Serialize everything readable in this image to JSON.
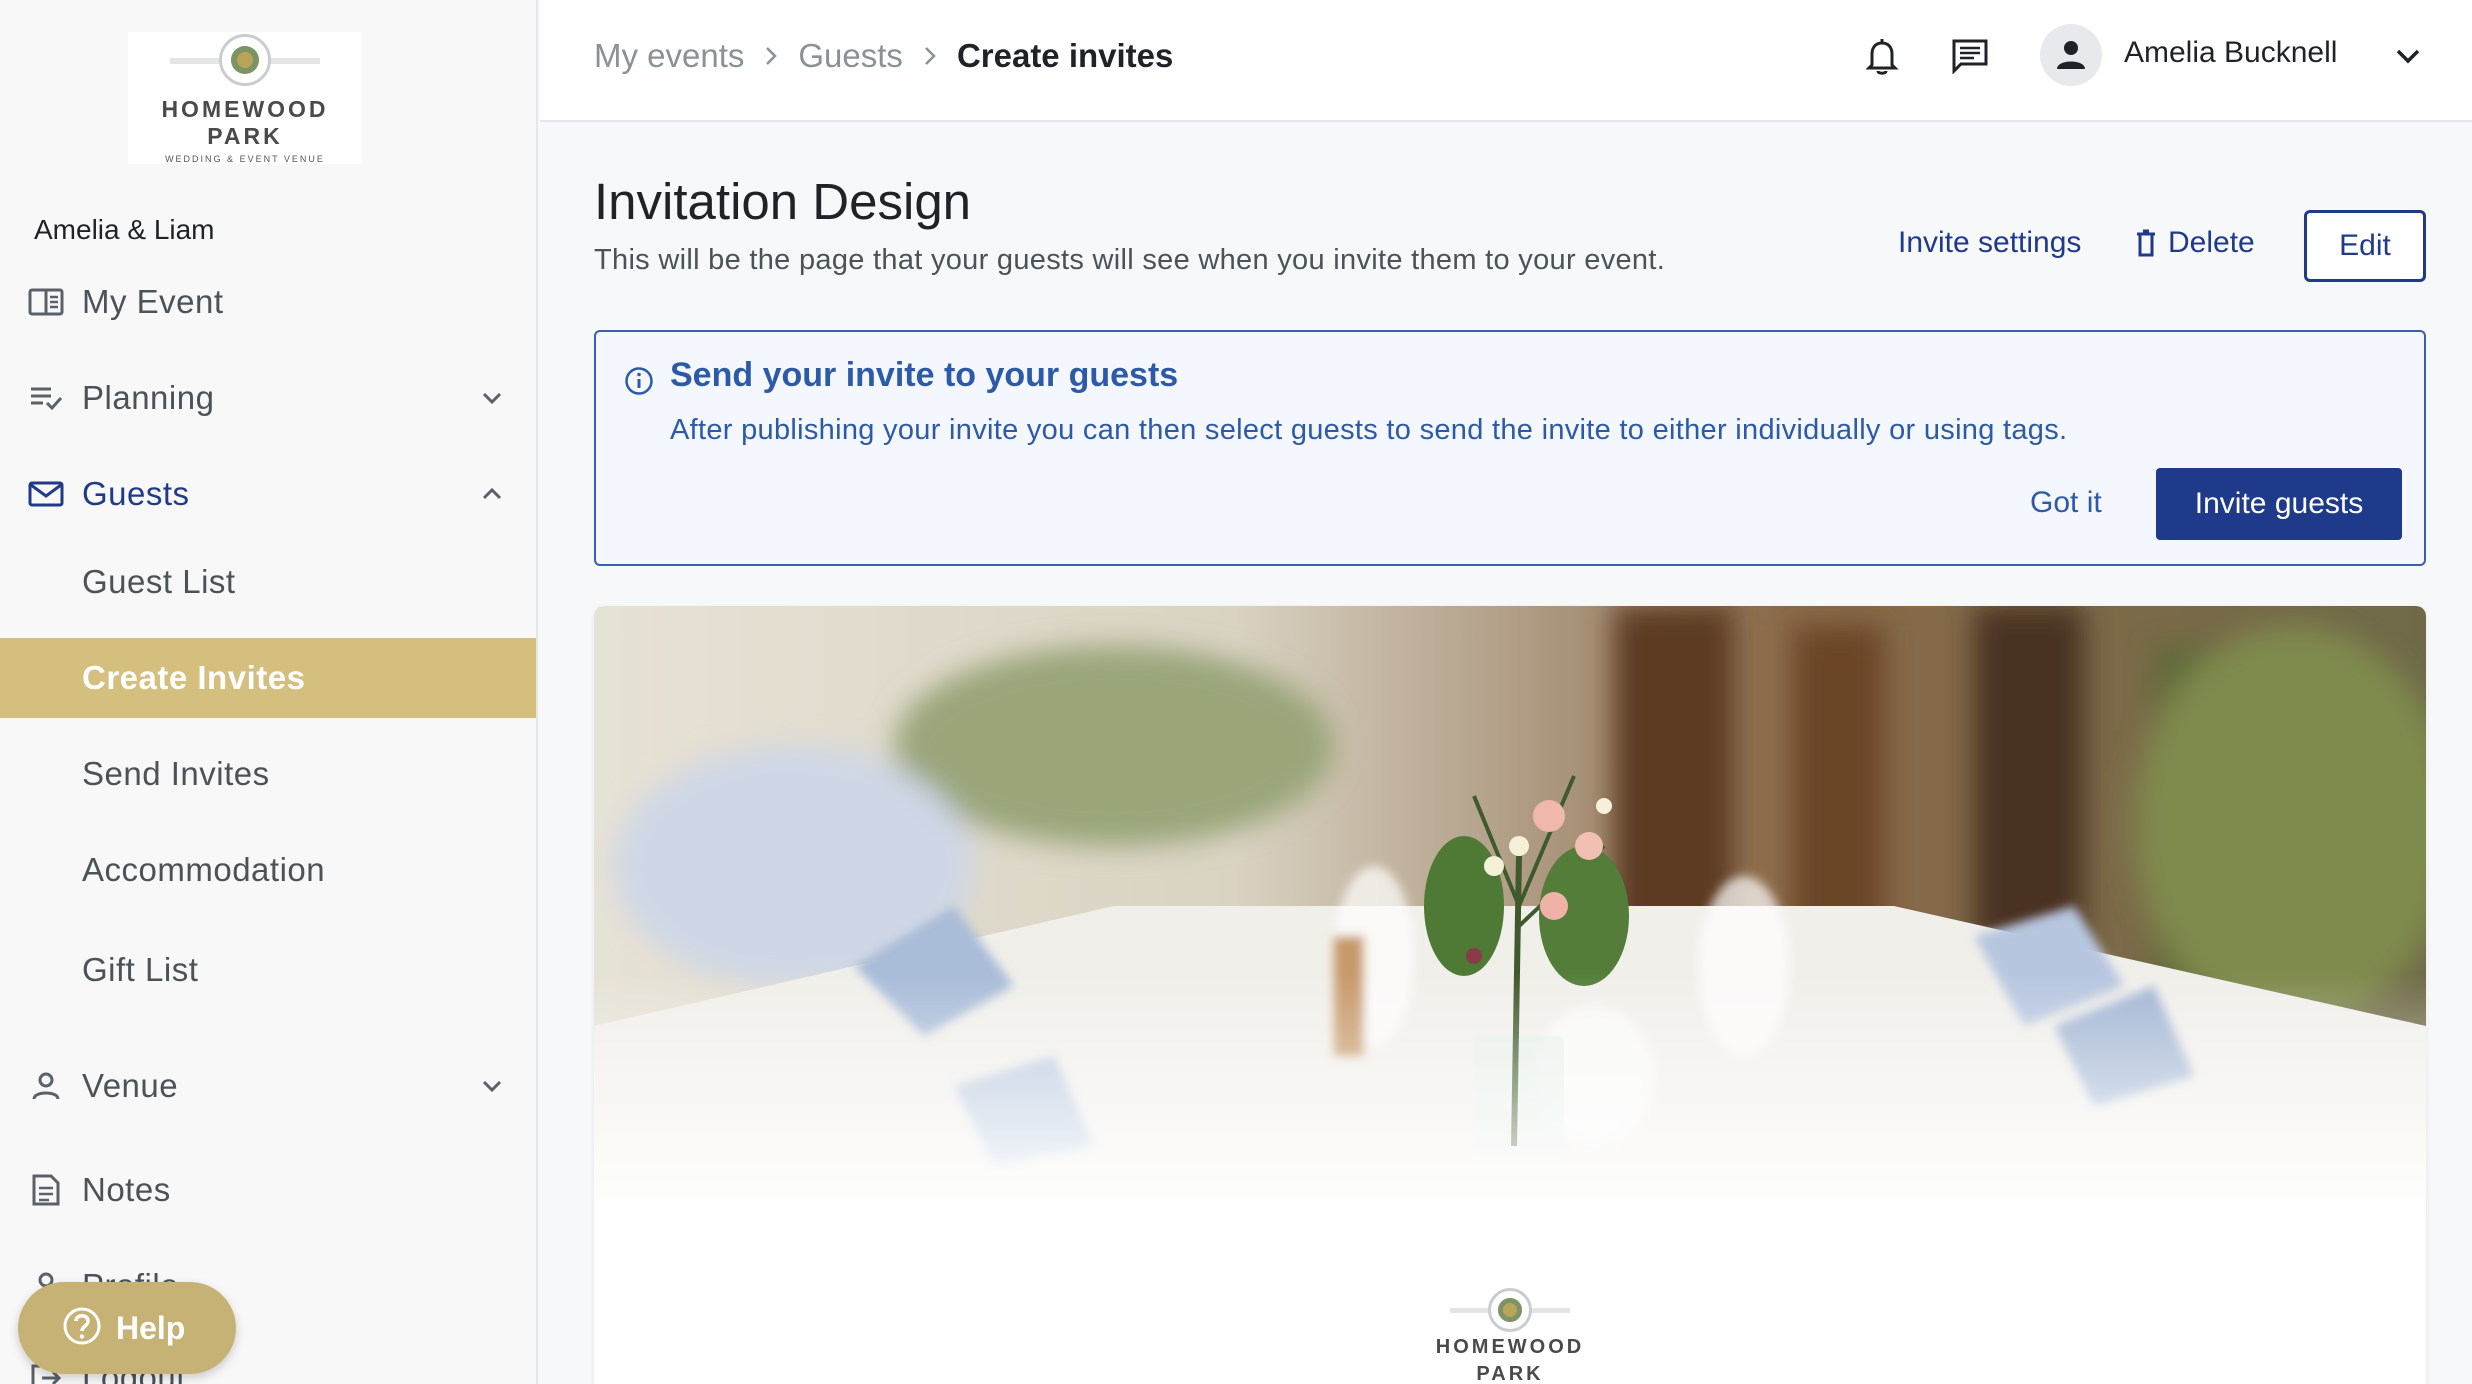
{
  "brand": {
    "logo_line1": "HOMEWOOD",
    "logo_line2": "PARK",
    "logo_tagline": "WEDDING & EVENT VENUE",
    "accent_color": "#d4bf7f",
    "primary_color": "#1f3a8a"
  },
  "sidebar": {
    "event_name": "Amelia & Liam",
    "items": [
      {
        "label": "My Event",
        "icon": "event-book-icon"
      },
      {
        "label": "Planning",
        "icon": "checklist-icon",
        "expanded": false
      },
      {
        "label": "Guests",
        "icon": "mail-icon",
        "expanded": true
      },
      {
        "label": "Venue",
        "icon": "person-icon",
        "expanded": false
      },
      {
        "label": "Notes",
        "icon": "notes-icon"
      },
      {
        "label": "Profile",
        "icon": "person-icon"
      },
      {
        "label": "Logout",
        "icon": "logout-icon"
      }
    ],
    "guest_subitems": [
      {
        "label": "Guest List"
      },
      {
        "label": "Create Invites",
        "selected": true
      },
      {
        "label": "Send Invites"
      },
      {
        "label": "Accommodation"
      },
      {
        "label": "Gift List"
      }
    ],
    "help_label": "Help"
  },
  "topbar": {
    "breadcrumbs": [
      "My events",
      "Guests",
      "Create invites"
    ],
    "user_name": "Amelia Bucknell",
    "icons": [
      "bell-icon",
      "chat-icon",
      "avatar-icon",
      "chevron-down-icon"
    ]
  },
  "main": {
    "title": "Invitation Design",
    "subtitle": "This will be the page that your guests will see when you invite them to your event.",
    "invite_settings_label": "Invite settings",
    "delete_label": "Delete",
    "edit_label": "Edit"
  },
  "notice": {
    "title": "Send your invite to your guests",
    "body": "After publishing your invite you can then select guests to send the invite to either individually or using tags.",
    "dismiss_label": "Got it",
    "action_label": "Invite guests"
  },
  "preview": {
    "logo_line1": "HOMEWOOD",
    "logo_line2": "PARK"
  }
}
